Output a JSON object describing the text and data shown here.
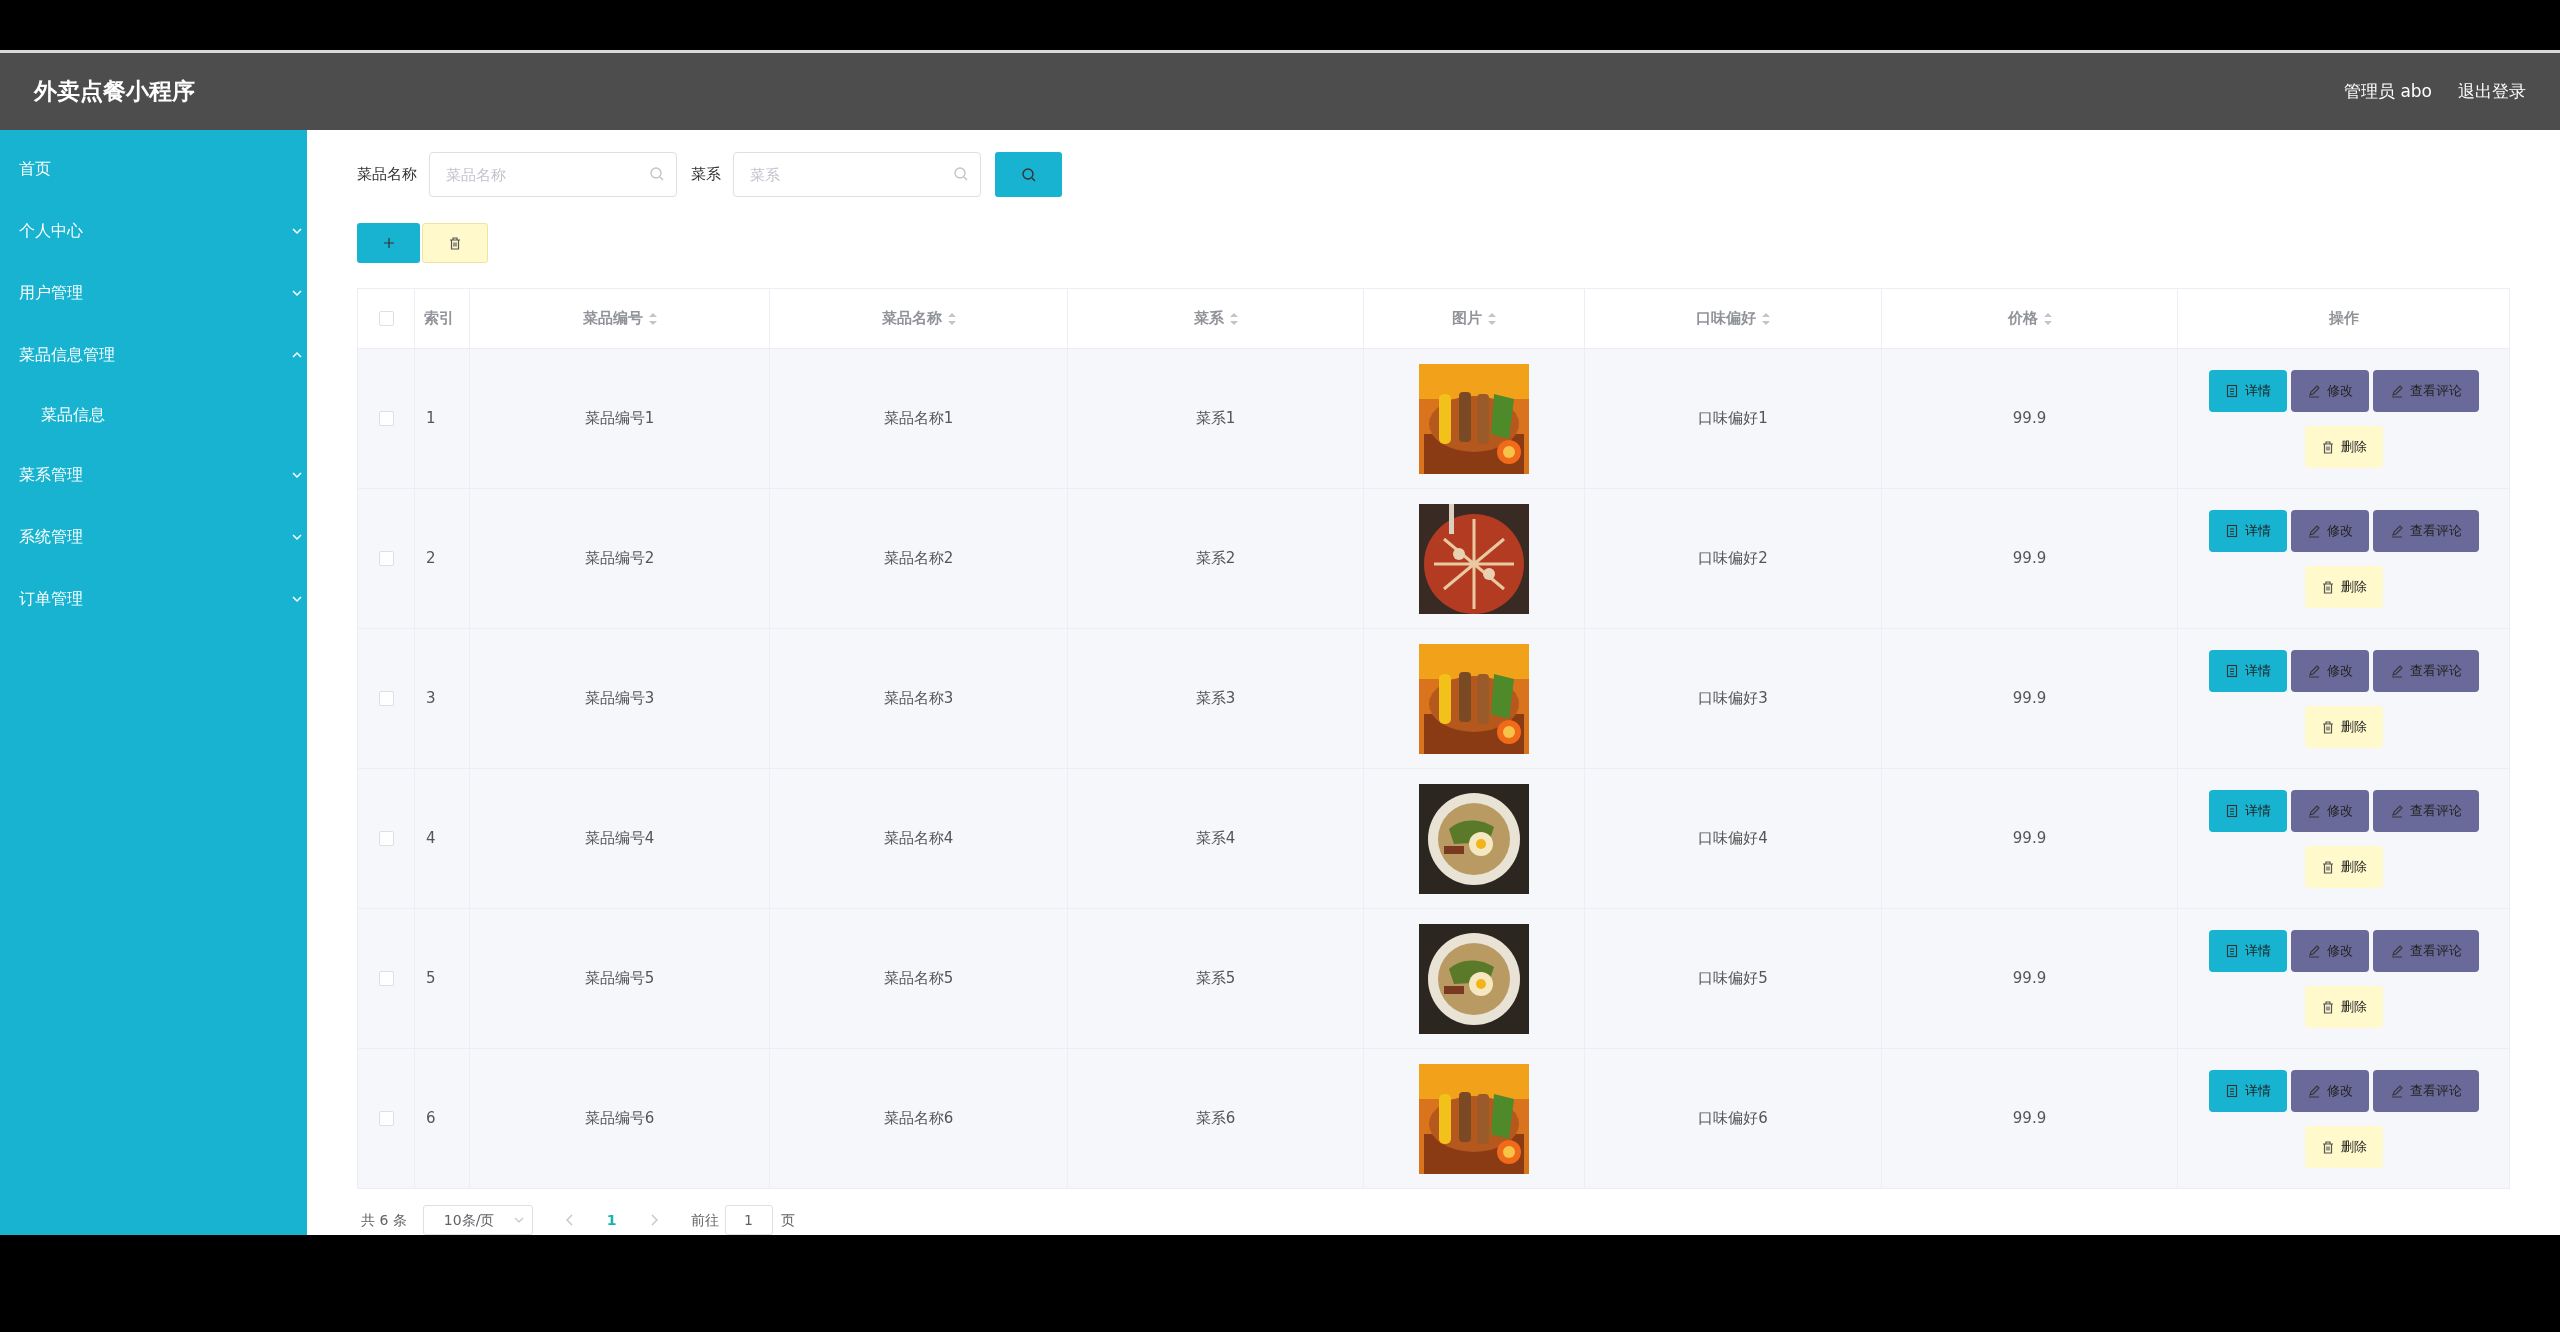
{
  "header": {
    "title": "外卖点餐小程序",
    "user": "管理员 abo",
    "logout": "退出登录"
  },
  "sidebar": {
    "items": [
      {
        "label": "首页",
        "kind": "link"
      },
      {
        "label": "个人中心",
        "kind": "submenu",
        "expanded": false
      },
      {
        "label": "用户管理",
        "kind": "submenu",
        "expanded": false
      },
      {
        "label": "菜品信息管理",
        "kind": "submenu",
        "expanded": true,
        "children": [
          {
            "label": "菜品信息"
          }
        ]
      },
      {
        "label": "菜系管理",
        "kind": "submenu",
        "expanded": false
      },
      {
        "label": "系统管理",
        "kind": "submenu",
        "expanded": false
      },
      {
        "label": "订单管理",
        "kind": "submenu",
        "expanded": false
      }
    ]
  },
  "search": [
    {
      "label": "菜品名称",
      "placeholder": "菜品名称"
    },
    {
      "label": "菜系",
      "placeholder": "菜系"
    }
  ],
  "table": {
    "all_checked": false,
    "columns": [
      {
        "label": "索引",
        "sortable": false
      },
      {
        "label": "菜品编号",
        "sortable": true
      },
      {
        "label": "菜品名称",
        "sortable": true
      },
      {
        "label": "菜系",
        "sortable": true
      },
      {
        "label": "图片",
        "sortable": true
      },
      {
        "label": "口味偏好",
        "sortable": true
      },
      {
        "label": "价格",
        "sortable": true
      },
      {
        "label": "操作",
        "sortable": false
      }
    ],
    "rows": [
      {
        "index": "1",
        "code": "菜品编号1",
        "name": "菜品名称1",
        "cuisine": "菜系1",
        "taste": "口味偏好1",
        "price": "99.9",
        "checked": false,
        "actions": [
          {
            "label": "详情",
            "kind": "detail"
          },
          {
            "label": "修改",
            "kind": "edit"
          },
          {
            "label": "查看评论",
            "kind": "comments"
          },
          {
            "label": "删除",
            "kind": "delete"
          }
        ]
      },
      {
        "index": "2",
        "code": "菜品编号2",
        "name": "菜品名称2",
        "cuisine": "菜系2",
        "taste": "口味偏好2",
        "price": "99.9",
        "checked": false,
        "actions": [
          {
            "label": "详情",
            "kind": "detail"
          },
          {
            "label": "修改",
            "kind": "edit"
          },
          {
            "label": "查看评论",
            "kind": "comments"
          },
          {
            "label": "删除",
            "kind": "delete"
          }
        ]
      },
      {
        "index": "3",
        "code": "菜品编号3",
        "name": "菜品名称3",
        "cuisine": "菜系3",
        "taste": "口味偏好3",
        "price": "99.9",
        "checked": false,
        "actions": [
          {
            "label": "详情",
            "kind": "detail"
          },
          {
            "label": "修改",
            "kind": "edit"
          },
          {
            "label": "查看评论",
            "kind": "comments"
          },
          {
            "label": "删除",
            "kind": "delete"
          }
        ]
      },
      {
        "index": "4",
        "code": "菜品编号4",
        "name": "菜品名称4",
        "cuisine": "菜系4",
        "taste": "口味偏好4",
        "price": "99.9",
        "checked": false,
        "actions": [
          {
            "label": "详情",
            "kind": "detail"
          },
          {
            "label": "修改",
            "kind": "edit"
          },
          {
            "label": "查看评论",
            "kind": "comments"
          },
          {
            "label": "删除",
            "kind": "delete"
          }
        ]
      },
      {
        "index": "5",
        "code": "菜品编号5",
        "name": "菜品名称5",
        "cuisine": "菜系5",
        "taste": "口味偏好5",
        "price": "99.9",
        "checked": false,
        "actions": [
          {
            "label": "详情",
            "kind": "detail"
          },
          {
            "label": "修改",
            "kind": "edit"
          },
          {
            "label": "查看评论",
            "kind": "comments"
          },
          {
            "label": "删除",
            "kind": "delete"
          }
        ]
      },
      {
        "index": "6",
        "code": "菜品编号6",
        "name": "菜品名称6",
        "cuisine": "菜系6",
        "taste": "口味偏好6",
        "price": "99.9",
        "checked": false,
        "actions": [
          {
            "label": "详情",
            "kind": "detail"
          },
          {
            "label": "修改",
            "kind": "edit"
          },
          {
            "label": "查看评论",
            "kind": "comments"
          },
          {
            "label": "删除",
            "kind": "delete"
          }
        ]
      }
    ]
  },
  "pagination": {
    "total": "共 6 条",
    "page_size": "10条/页",
    "pages": [
      {
        "label": "1",
        "selected": true
      }
    ],
    "goto_label": "前往",
    "goto_value": "1",
    "goto_suffix": "页"
  }
}
